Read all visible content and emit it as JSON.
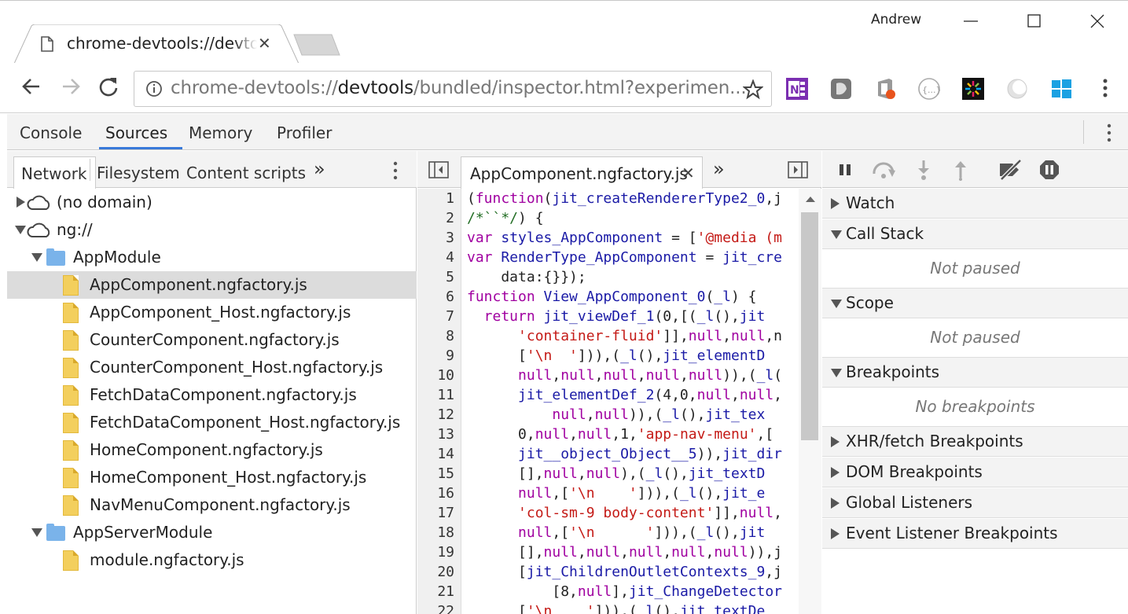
{
  "browser": {
    "tab_title": "chrome-devtools://devtools/bundled/inspector.html",
    "user_name": "Andrew",
    "url_scheme": "chrome-devtools://",
    "url_host": "devtools",
    "url_path": "/bundled/inspector.html?experimen...",
    "extensions": [
      "onenote-icon",
      "grey-extension-icon",
      "office-icon",
      "json-viewer-icon",
      "colorful-extension-icon",
      "silver-extension-icon",
      "windows-icon"
    ]
  },
  "devtools": {
    "tabs": [
      "Console",
      "Sources",
      "Memory",
      "Profiler"
    ],
    "active_tab": "Sources"
  },
  "navigator": {
    "tabs": [
      "Network",
      "Filesystem",
      "Content scripts"
    ],
    "tree": [
      {
        "label": "(no domain)",
        "type": "domain",
        "expanded": false,
        "depth": 0
      },
      {
        "label": "ng://",
        "type": "domain",
        "expanded": true,
        "depth": 0
      },
      {
        "label": "AppModule",
        "type": "folder",
        "expanded": true,
        "depth": 1
      },
      {
        "label": "AppComponent.ngfactory.js",
        "type": "file",
        "depth": 2,
        "selected": true
      },
      {
        "label": "AppComponent_Host.ngfactory.js",
        "type": "file",
        "depth": 2
      },
      {
        "label": "CounterComponent.ngfactory.js",
        "type": "file",
        "depth": 2
      },
      {
        "label": "CounterComponent_Host.ngfactory.js",
        "type": "file",
        "depth": 2
      },
      {
        "label": "FetchDataComponent.ngfactory.js",
        "type": "file",
        "depth": 2
      },
      {
        "label": "FetchDataComponent_Host.ngfactory.js",
        "type": "file",
        "depth": 2
      },
      {
        "label": "HomeComponent.ngfactory.js",
        "type": "file",
        "depth": 2
      },
      {
        "label": "HomeComponent_Host.ngfactory.js",
        "type": "file",
        "depth": 2
      },
      {
        "label": "NavMenuComponent.ngfactory.js",
        "type": "file",
        "depth": 2
      },
      {
        "label": "AppServerModule",
        "type": "folder",
        "expanded": true,
        "depth": 1
      },
      {
        "label": "module.ngfactory.js",
        "type": "file",
        "depth": 2
      }
    ]
  },
  "editor": {
    "file_tab": "AppComponent.ngfactory.js",
    "lines": [
      [
        {
          "t": "(",
          "c": ""
        },
        {
          "t": "function",
          "c": "kw"
        },
        {
          "t": "(",
          "c": ""
        },
        {
          "t": "jit_createRendererType2_0",
          "c": "id"
        },
        {
          "t": ",j",
          "c": ""
        }
      ],
      [
        {
          "t": "/*``*/",
          "c": "cm"
        },
        {
          "t": ") {",
          "c": ""
        }
      ],
      [
        {
          "t": "var ",
          "c": "kw"
        },
        {
          "t": "styles_AppComponent",
          "c": "id"
        },
        {
          "t": " = [",
          "c": ""
        },
        {
          "t": "'@media (m",
          "c": "str"
        }
      ],
      [
        {
          "t": "var ",
          "c": "kw"
        },
        {
          "t": "RenderType_AppComponent",
          "c": "id"
        },
        {
          "t": " = ",
          "c": ""
        },
        {
          "t": "jit_cre",
          "c": "id"
        }
      ],
      [
        {
          "t": "    data:{}});",
          "c": ""
        }
      ],
      [
        {
          "t": "function ",
          "c": "kw"
        },
        {
          "t": "View_AppComponent_0",
          "c": "id"
        },
        {
          "t": "(",
          "c": ""
        },
        {
          "t": "_l",
          "c": "id"
        },
        {
          "t": ") {",
          "c": ""
        }
      ],
      [
        {
          "t": "  return ",
          "c": "kw"
        },
        {
          "t": "jit_viewDef_1",
          "c": "id"
        },
        {
          "t": "(0,[(",
          "c": ""
        },
        {
          "t": "_l",
          "c": "id"
        },
        {
          "t": "(),",
          "c": ""
        },
        {
          "t": "jit",
          "c": "id"
        }
      ],
      [
        {
          "t": "      ",
          "c": ""
        },
        {
          "t": "'container-fluid'",
          "c": "str"
        },
        {
          "t": "]],",
          "c": ""
        },
        {
          "t": "null",
          "c": "kw"
        },
        {
          "t": ",",
          "c": ""
        },
        {
          "t": "null",
          "c": "kw"
        },
        {
          "t": ",n",
          "c": ""
        }
      ],
      [
        {
          "t": "      [",
          "c": ""
        },
        {
          "t": "'\\n  '",
          "c": "str"
        },
        {
          "t": "])),(",
          "c": ""
        },
        {
          "t": "_l",
          "c": "id"
        },
        {
          "t": "(),",
          "c": ""
        },
        {
          "t": "jit_elementD",
          "c": "id"
        }
      ],
      [
        {
          "t": "      ",
          "c": ""
        },
        {
          "t": "null",
          "c": "kw"
        },
        {
          "t": ",",
          "c": ""
        },
        {
          "t": "null",
          "c": "kw"
        },
        {
          "t": ",",
          "c": ""
        },
        {
          "t": "null",
          "c": "kw"
        },
        {
          "t": ",",
          "c": ""
        },
        {
          "t": "null",
          "c": "kw"
        },
        {
          "t": ",",
          "c": ""
        },
        {
          "t": "null",
          "c": "kw"
        },
        {
          "t": ")),(",
          "c": ""
        },
        {
          "t": "_l",
          "c": "id"
        },
        {
          "t": "(",
          "c": ""
        }
      ],
      [
        {
          "t": "      ",
          "c": ""
        },
        {
          "t": "jit_elementDef_2",
          "c": "id"
        },
        {
          "t": "(4,0,",
          "c": ""
        },
        {
          "t": "null",
          "c": "kw"
        },
        {
          "t": ",",
          "c": ""
        },
        {
          "t": "null",
          "c": "kw"
        },
        {
          "t": ",",
          "c": ""
        }
      ],
      [
        {
          "t": "          ",
          "c": ""
        },
        {
          "t": "null",
          "c": "kw"
        },
        {
          "t": ",",
          "c": ""
        },
        {
          "t": "null",
          "c": "kw"
        },
        {
          "t": ")),(",
          "c": ""
        },
        {
          "t": "_l",
          "c": "id"
        },
        {
          "t": "(),",
          "c": ""
        },
        {
          "t": "jit_tex",
          "c": "id"
        }
      ],
      [
        {
          "t": "      0,",
          "c": ""
        },
        {
          "t": "null",
          "c": "kw"
        },
        {
          "t": ",",
          "c": ""
        },
        {
          "t": "null",
          "c": "kw"
        },
        {
          "t": ",1,",
          "c": ""
        },
        {
          "t": "'app-nav-menu'",
          "c": "str"
        },
        {
          "t": ",[",
          "c": ""
        }
      ],
      [
        {
          "t": "      ",
          "c": ""
        },
        {
          "t": "jit__object_Object__5",
          "c": "id"
        },
        {
          "t": ")),",
          "c": ""
        },
        {
          "t": "jit_dir",
          "c": "id"
        }
      ],
      [
        {
          "t": "      [],",
          "c": ""
        },
        {
          "t": "null",
          "c": "kw"
        },
        {
          "t": ",",
          "c": ""
        },
        {
          "t": "null",
          "c": "kw"
        },
        {
          "t": "),(",
          "c": ""
        },
        {
          "t": "_l",
          "c": "id"
        },
        {
          "t": "(),",
          "c": ""
        },
        {
          "t": "jit_textD",
          "c": "id"
        }
      ],
      [
        {
          "t": "      ",
          "c": ""
        },
        {
          "t": "null",
          "c": "kw"
        },
        {
          "t": ",[",
          "c": ""
        },
        {
          "t": "'\\n    '",
          "c": "str"
        },
        {
          "t": "])),(",
          "c": ""
        },
        {
          "t": "_l",
          "c": "id"
        },
        {
          "t": "(),",
          "c": ""
        },
        {
          "t": "jit_e",
          "c": "id"
        }
      ],
      [
        {
          "t": "      ",
          "c": ""
        },
        {
          "t": "'col-sm-9 body-content'",
          "c": "str"
        },
        {
          "t": "]],",
          "c": ""
        },
        {
          "t": "null",
          "c": "kw"
        },
        {
          "t": ",",
          "c": ""
        }
      ],
      [
        {
          "t": "      ",
          "c": ""
        },
        {
          "t": "null",
          "c": "kw"
        },
        {
          "t": ",[",
          "c": ""
        },
        {
          "t": "'\\n      '",
          "c": "str"
        },
        {
          "t": "])),(",
          "c": ""
        },
        {
          "t": "_l",
          "c": "id"
        },
        {
          "t": "(),",
          "c": ""
        },
        {
          "t": "jit",
          "c": "id"
        }
      ],
      [
        {
          "t": "      [],",
          "c": ""
        },
        {
          "t": "null",
          "c": "kw"
        },
        {
          "t": ",",
          "c": ""
        },
        {
          "t": "null",
          "c": "kw"
        },
        {
          "t": ",",
          "c": ""
        },
        {
          "t": "null",
          "c": "kw"
        },
        {
          "t": ",",
          "c": ""
        },
        {
          "t": "null",
          "c": "kw"
        },
        {
          "t": ",",
          "c": ""
        },
        {
          "t": "null",
          "c": "kw"
        },
        {
          "t": ")),j",
          "c": ""
        }
      ],
      [
        {
          "t": "      [",
          "c": ""
        },
        {
          "t": "jit_ChildrenOutletContexts_9",
          "c": "id"
        },
        {
          "t": ",j",
          "c": ""
        }
      ],
      [
        {
          "t": "          [8,",
          "c": ""
        },
        {
          "t": "null",
          "c": "kw"
        },
        {
          "t": "],",
          "c": ""
        },
        {
          "t": "jit_ChangeDetector",
          "c": "id"
        }
      ],
      [
        {
          "t": "      [",
          "c": ""
        },
        {
          "t": "'\\n    '",
          "c": "str"
        },
        {
          "t": "])),(",
          "c": ""
        },
        {
          "t": "_l",
          "c": "id"
        },
        {
          "t": "(),",
          "c": ""
        },
        {
          "t": "jit_textDe",
          "c": "id"
        }
      ]
    ]
  },
  "debugger": {
    "sections": [
      {
        "label": "Watch",
        "expanded": false
      },
      {
        "label": "Call Stack",
        "expanded": true,
        "empty": "Not paused"
      },
      {
        "label": "Scope",
        "expanded": true,
        "empty": "Not paused"
      },
      {
        "label": "Breakpoints",
        "expanded": true,
        "empty": "No breakpoints"
      },
      {
        "label": "XHR/fetch Breakpoints",
        "expanded": false
      },
      {
        "label": "DOM Breakpoints",
        "expanded": false
      },
      {
        "label": "Global Listeners",
        "expanded": false
      },
      {
        "label": "Event Listener Breakpoints",
        "expanded": false
      }
    ]
  }
}
